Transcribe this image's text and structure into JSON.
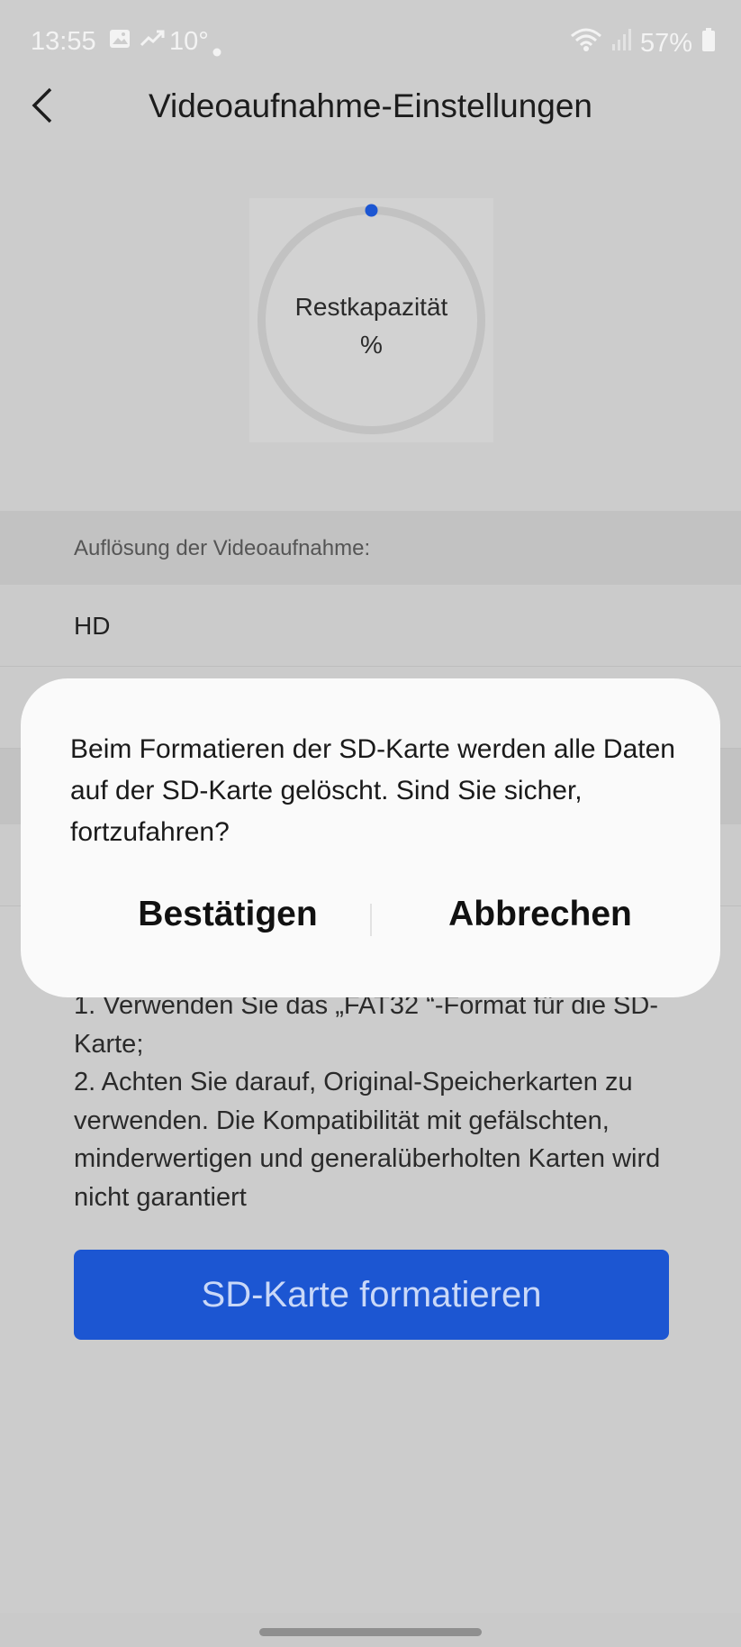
{
  "status_bar": {
    "time": "13:55",
    "temperature": "10°",
    "battery": "57%",
    "icons": [
      "gallery-icon",
      "trending-icon",
      "dot-icon",
      "wifi-icon",
      "signal-icon",
      "battery-icon"
    ]
  },
  "header": {
    "title": "Videoaufnahme-Einstellungen",
    "back_icon": "chevron-left-icon"
  },
  "capacity": {
    "label": "Restkapazität",
    "value": "%",
    "accent_color": "#1c56d2"
  },
  "resolution": {
    "section_label": "Auflösung der Videoaufnahme:",
    "selected": "HD"
  },
  "hints": {
    "line1": "1. Verwenden Sie das „FAT32 “-Format für die SD-Karte;",
    "line2": "2. Achten Sie darauf, Original-Speicherkarten zu verwenden. Die Kompatibilität mit gefälschten, minderwertigen und generalüberholten Karten wird nicht garantiert"
  },
  "format_button": {
    "label": "SD-Karte formatieren",
    "color": "#1c56d2"
  },
  "dialog": {
    "message": "Beim Formatieren der SD-Karte werden alle Daten auf der SD-Karte gelöscht. Sind Sie sicher, fortzufahren?",
    "confirm_label": "Bestätigen",
    "cancel_label": "Abbrechen"
  }
}
